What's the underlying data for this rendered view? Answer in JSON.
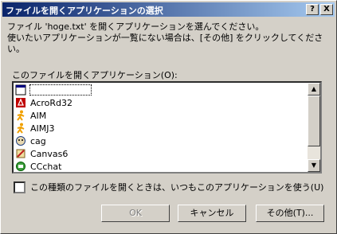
{
  "window": {
    "title": "ファイルを開くアプリケーションの選択",
    "help_label": "?",
    "close_label": "X"
  },
  "description": "ファイル 'hoge.txt' を開くアプリケーションを選んでください。\n使いたいアプリケーションが一覧にない場合は、[その他] をクリックしてくださ\nい。",
  "list": {
    "label": "このファイルを開くアプリケーション(O):",
    "items": [
      {
        "label": "",
        "icon": "blank-document-icon"
      },
      {
        "label": "AcroRd32",
        "icon": "acrobat-reader-icon",
        "color": "#c00000"
      },
      {
        "label": "AIM",
        "icon": "aim-running-man-icon",
        "color": "#f0a000"
      },
      {
        "label": "AIMJ3",
        "icon": "aim-running-man-icon",
        "color": "#f0a000"
      },
      {
        "label": "cag",
        "icon": "cag-app-icon",
        "color": "#204080"
      },
      {
        "label": "Canvas6",
        "icon": "canvas-brush-icon",
        "color": "#c02020"
      },
      {
        "label": "CCchat",
        "icon": "ccchat-app-icon",
        "color": "#008000"
      }
    ]
  },
  "checkbox": {
    "label": "この種類のファイルを開くときは、いつもこのアプリケーションを使う(U)",
    "checked": false
  },
  "buttons": {
    "ok": "OK",
    "cancel": "キャンセル",
    "other": "その他(T)..."
  },
  "colors": {
    "titlebar_start": "#0a246a",
    "titlebar_end": "#a6caf0",
    "face": "#d4d0c8"
  }
}
